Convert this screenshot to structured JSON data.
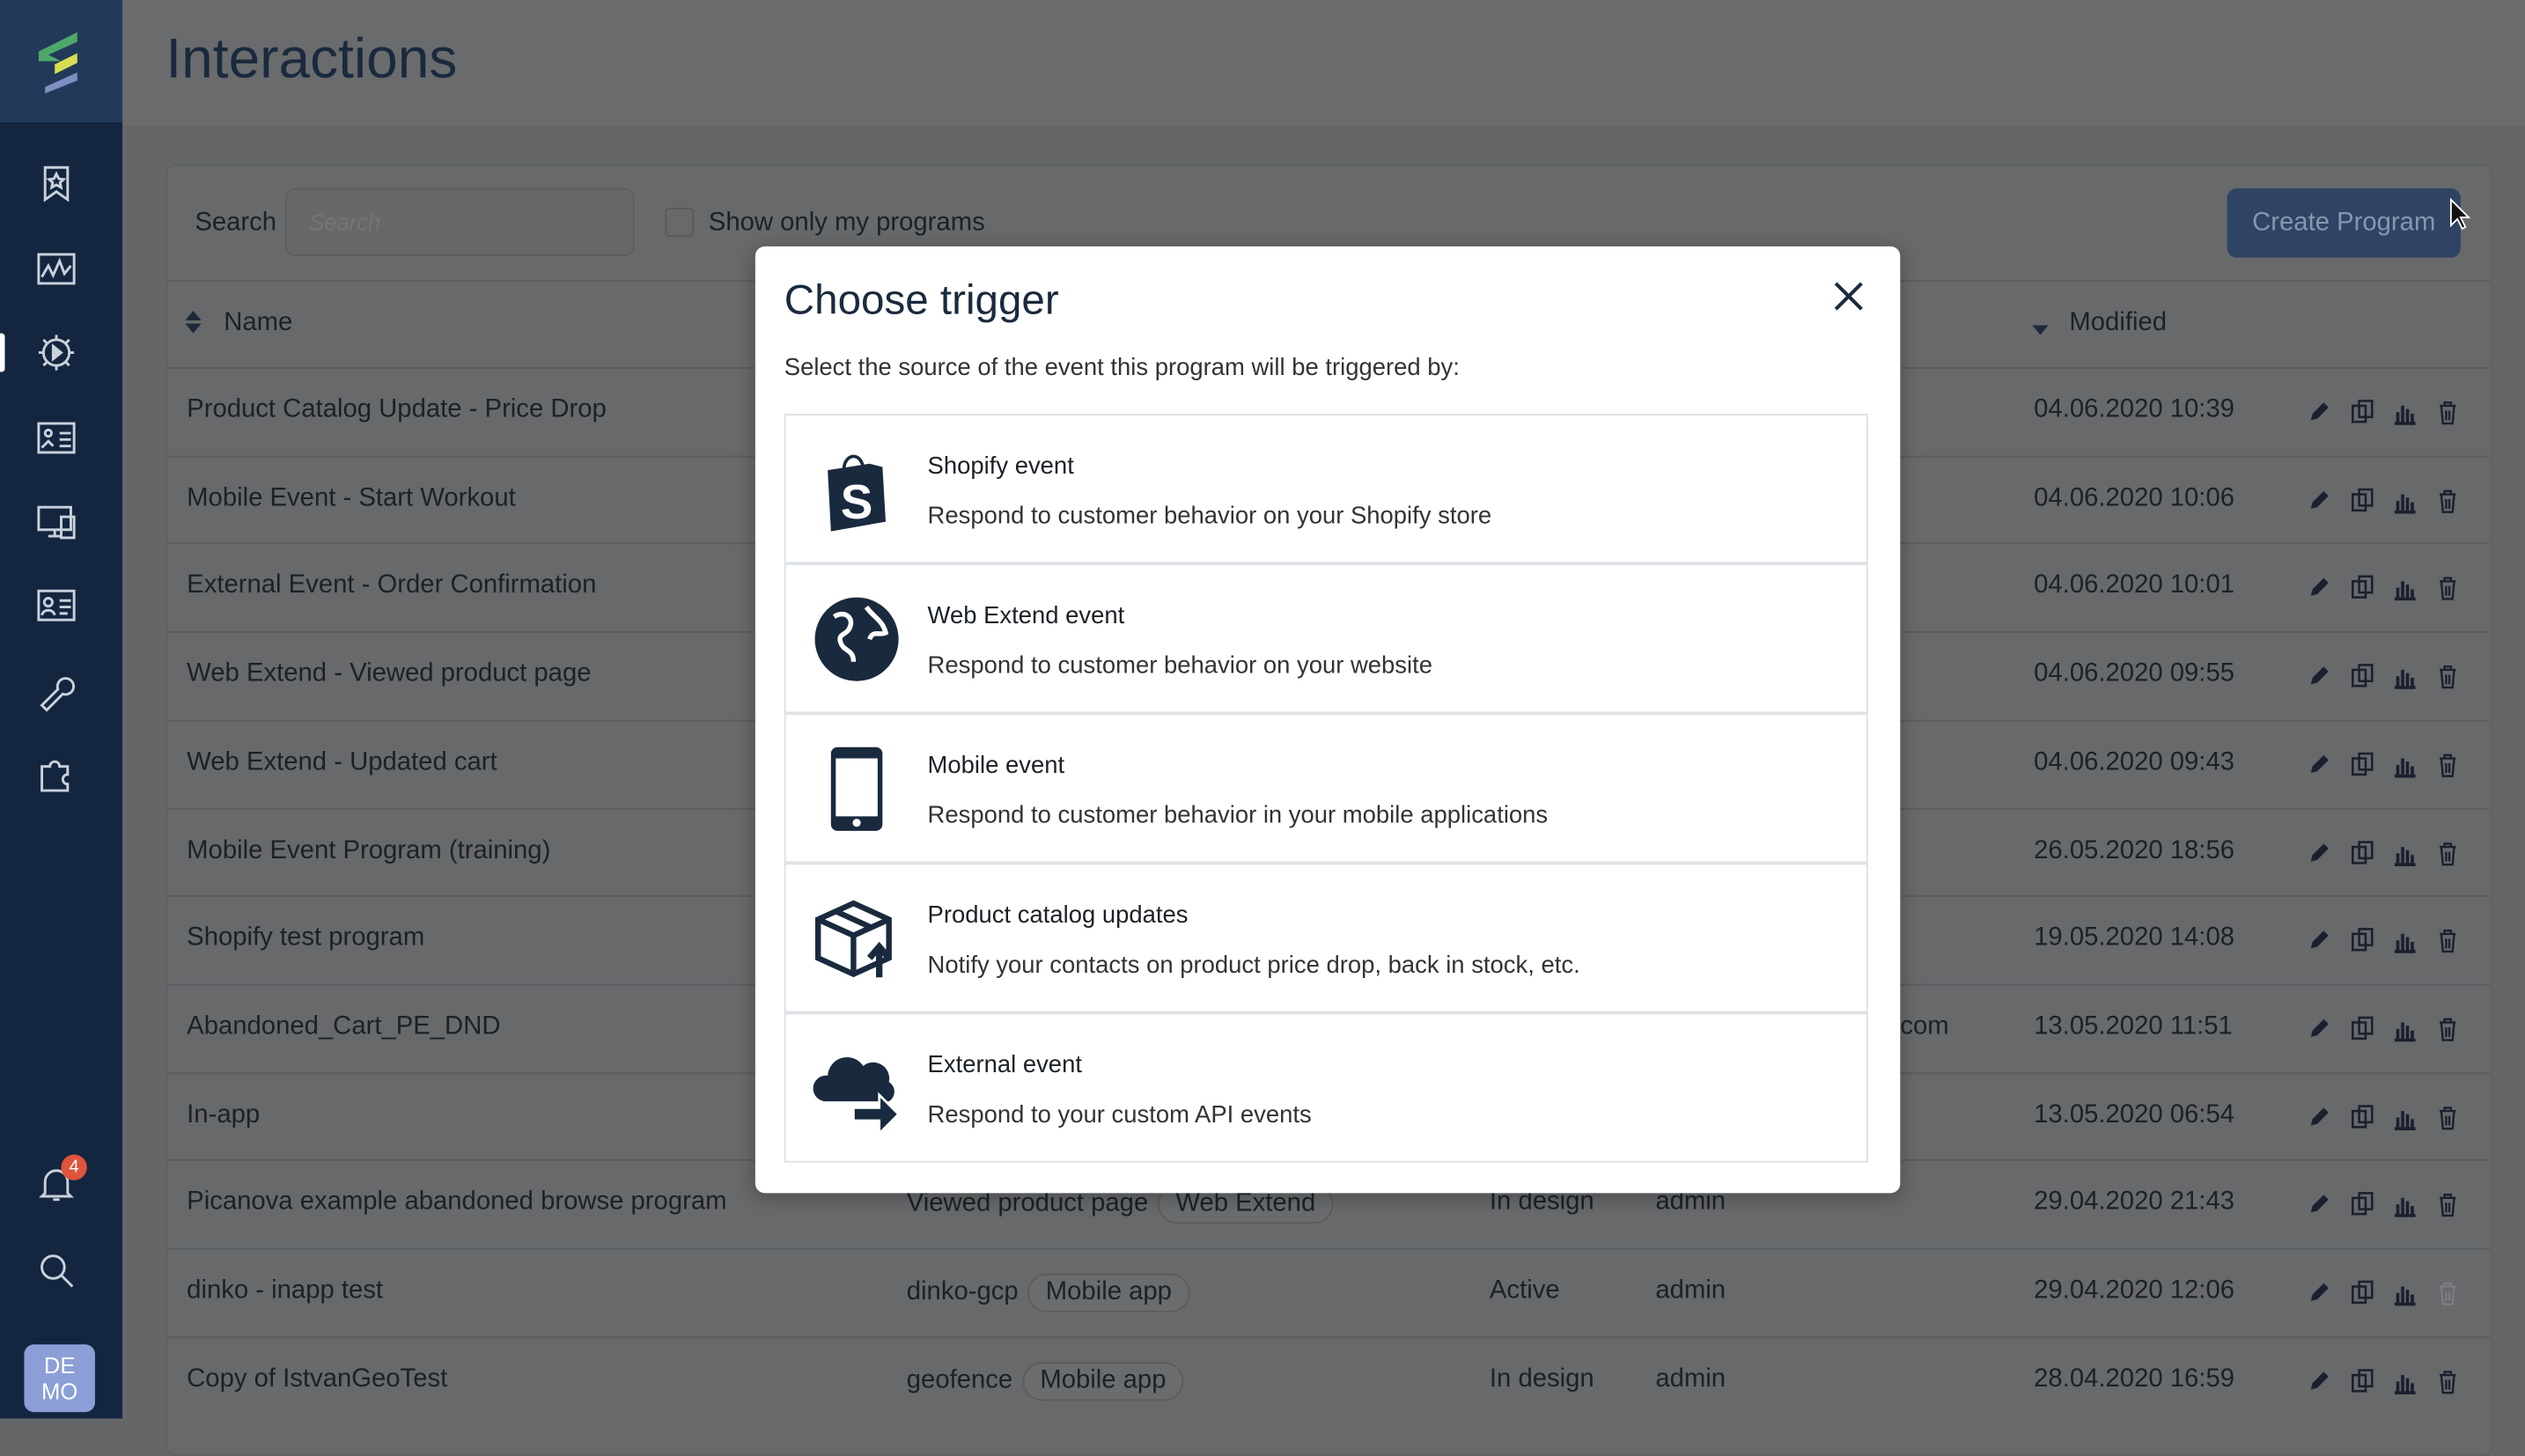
{
  "colors": {
    "sidebar": "#14253f",
    "accent": "#2f4464",
    "badge": "#e0533d",
    "avatar": "#8b9fd6"
  },
  "sidebar": {
    "logo": "app-logo",
    "items": [
      {
        "icon": "bookmark-star-icon"
      },
      {
        "icon": "chart-line-icon"
      },
      {
        "icon": "gear-play-icon",
        "active": true
      },
      {
        "icon": "image-list-icon"
      },
      {
        "icon": "devices-icon"
      },
      {
        "icon": "contact-card-icon"
      },
      {
        "icon": "wrench-icon"
      },
      {
        "icon": "puzzle-icon"
      }
    ],
    "notifications": {
      "icon": "bell-icon",
      "count": "4"
    },
    "search_icon": "search-icon",
    "avatar": {
      "line1": "DE",
      "line2": "MO"
    }
  },
  "header": {
    "title": "Interactions"
  },
  "toolbar": {
    "search_label": "Search",
    "search_placeholder": "Search",
    "search_value": "",
    "my_programs_label": "Show only my programs",
    "my_programs_checked": false,
    "create_label": "Create Program"
  },
  "table": {
    "columns": {
      "name": "Name",
      "modified": "Modified"
    },
    "rows": [
      {
        "name": "Product Catalog Update - Price Drop",
        "modified": "04.06.2020 10:39"
      },
      {
        "name": "Mobile Event - Start Workout",
        "modified": "04.06.2020 10:06"
      },
      {
        "name": "External Event - Order Confirmation",
        "modified": "04.06.2020 10:01"
      },
      {
        "name": "Web Extend - Viewed product page",
        "modified": "04.06.2020 09:55"
      },
      {
        "name": "Web Extend - Updated cart",
        "modified": "04.06.2020 09:43"
      },
      {
        "name": "Mobile Event Program (training)",
        "modified": "26.05.2020 18:56"
      },
      {
        "name": "Shopify test program",
        "modified": "19.05.2020 14:08"
      },
      {
        "name": "Abandoned_Cart_PE_DND",
        "owner": "com",
        "modified": "13.05.2020 11:51"
      },
      {
        "name": "In-app",
        "modified": "13.05.2020 06:54"
      },
      {
        "name": "Picanova example abandoned browse program",
        "trigger": "Viewed product page",
        "tag": "Web Extend",
        "status": "In design",
        "owner": "admin",
        "modified": "29.04.2020 21:43"
      },
      {
        "name": "dinko - inapp test",
        "trigger": "dinko-gcp",
        "tag": "Mobile app",
        "status": "Active",
        "owner": "admin",
        "modified": "29.04.2020 12:06",
        "delete_disabled": true
      },
      {
        "name": "Copy of IstvanGeoTest",
        "trigger": "geofence",
        "tag": "Mobile app",
        "status": "In design",
        "owner": "admin",
        "modified": "28.04.2020 16:59"
      }
    ]
  },
  "modal": {
    "title": "Choose trigger",
    "subtitle": "Select the source of the event this program will be triggered by:",
    "options": [
      {
        "icon": "shopify-bag-icon",
        "title": "Shopify event",
        "desc": "Respond to customer behavior on your Shopify store"
      },
      {
        "icon": "globe-icon",
        "title": "Web Extend event",
        "desc": "Respond to customer behavior on your website"
      },
      {
        "icon": "mobile-phone-icon",
        "title": "Mobile event",
        "desc": "Respond to customer behavior in your mobile applications"
      },
      {
        "icon": "package-arrow-icon",
        "title": "Product catalog updates",
        "desc": "Notify your contacts on product price drop, back in stock, etc."
      },
      {
        "icon": "cloud-arrow-icon",
        "title": "External event",
        "desc": "Respond to your custom API events"
      }
    ]
  }
}
